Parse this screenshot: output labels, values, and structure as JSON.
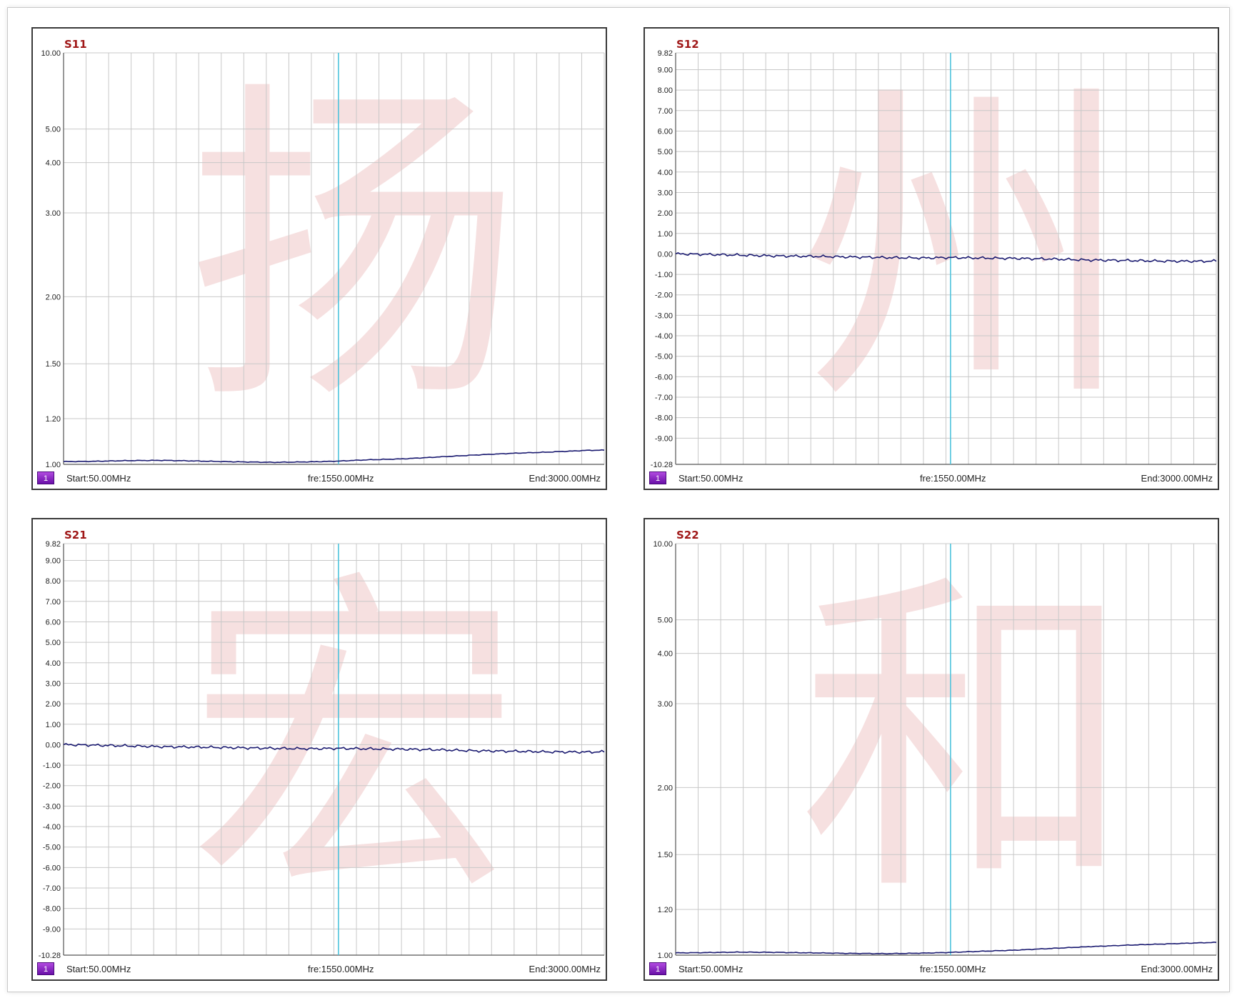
{
  "colors": {
    "grid": "#c8c8c8",
    "trace": "#1a1a70",
    "marker_line": "#4ec3dc",
    "title": "#a01818",
    "marker_badge": "#8a2bd0",
    "watermark": "#e9b4b4"
  },
  "panels": [
    {
      "title": "S11",
      "watermark": "扬",
      "marker_badge": "1",
      "start_label": "Start:50.00MHz",
      "fre_label": "fre:1550.00MHz",
      "end_label": "End:3000.00MHz"
    },
    {
      "title": "S12",
      "watermark": "州",
      "marker_badge": "1",
      "start_label": "Start:50.00MHz",
      "fre_label": "fre:1550.00MHz",
      "end_label": "End:3000.00MHz"
    },
    {
      "title": "S21",
      "watermark": "宏",
      "marker_badge": "1",
      "start_label": "Start:50.00MHz",
      "fre_label": "fre:1550.00MHz",
      "end_label": "End:3000.00MHz"
    },
    {
      "title": "S22",
      "watermark": "和",
      "marker_badge": "1",
      "start_label": "Start:50.00MHz",
      "fre_label": "fre:1550.00MHz",
      "end_label": "End:3000.00MHz"
    }
  ],
  "chart_data": [
    {
      "type": "line",
      "title": "S11",
      "scale": "vswr",
      "xlim": [
        50,
        3000
      ],
      "marker_x": 1550,
      "ylim": [
        1.0,
        10.0
      ],
      "yticks": [
        1.0,
        1.2,
        1.5,
        2.0,
        3.0,
        4.0,
        5.0,
        10.0
      ],
      "ytick_labels": [
        "1.00",
        "1.20",
        "1.50",
        "2.00",
        "3.00",
        "4.00",
        "5.00",
        "10.00"
      ],
      "grid": true,
      "series": [
        {
          "x": [
            50,
            200,
            400,
            600,
            800,
            1000,
            1200,
            1400,
            1550,
            1700,
            1900,
            2100,
            2300,
            2500,
            2700,
            2900,
            3000
          ],
          "values": [
            1.011,
            1.012,
            1.015,
            1.016,
            1.013,
            1.01,
            1.008,
            1.01,
            1.013,
            1.018,
            1.022,
            1.03,
            1.038,
            1.045,
            1.05,
            1.057,
            1.058
          ]
        }
      ]
    },
    {
      "type": "line",
      "title": "S12",
      "scale": "linear",
      "xlim": [
        50,
        3000
      ],
      "marker_x": 1550,
      "ylim": [
        -10.28,
        9.82
      ],
      "yticks": [
        -10.28,
        -9,
        -8,
        -7,
        -6,
        -5,
        -4,
        -3,
        -2,
        -1,
        0,
        1,
        2,
        3,
        4,
        5,
        6,
        7,
        8,
        9,
        9.82
      ],
      "ytick_labels": [
        "-10.28",
        "-9.00",
        "-8.00",
        "-7.00",
        "-6.00",
        "-5.00",
        "-4.00",
        "-3.00",
        "-2.00",
        "-1.00",
        "0.00",
        "1.00",
        "2.00",
        "3.00",
        "4.00",
        "5.00",
        "6.00",
        "7.00",
        "8.00",
        "9.00",
        "9.82"
      ],
      "grid": true,
      "series": [
        {
          "x": [
            50,
            200,
            400,
            600,
            800,
            1000,
            1200,
            1400,
            1550,
            1700,
            1900,
            2100,
            2300,
            2500,
            2700,
            2900,
            3000
          ],
          "values": [
            0.0,
            -0.02,
            -0.06,
            -0.1,
            -0.12,
            -0.15,
            -0.18,
            -0.2,
            -0.18,
            -0.2,
            -0.22,
            -0.25,
            -0.3,
            -0.32,
            -0.35,
            -0.36,
            -0.35
          ]
        }
      ]
    },
    {
      "type": "line",
      "title": "S21",
      "scale": "linear",
      "xlim": [
        50,
        3000
      ],
      "marker_x": 1550,
      "ylim": [
        -10.28,
        9.82
      ],
      "yticks": [
        -10.28,
        -9,
        -8,
        -7,
        -6,
        -5,
        -4,
        -3,
        -2,
        -1,
        0,
        1,
        2,
        3,
        4,
        5,
        6,
        7,
        8,
        9,
        9.82
      ],
      "ytick_labels": [
        "-10.28",
        "-9.00",
        "-8.00",
        "-7.00",
        "-6.00",
        "-5.00",
        "-4.00",
        "-3.00",
        "-2.00",
        "-1.00",
        "0.00",
        "1.00",
        "2.00",
        "3.00",
        "4.00",
        "5.00",
        "6.00",
        "7.00",
        "8.00",
        "9.00",
        "9.82"
      ],
      "grid": true,
      "series": [
        {
          "x": [
            50,
            200,
            400,
            600,
            800,
            1000,
            1200,
            1400,
            1550,
            1700,
            1900,
            2100,
            2300,
            2500,
            2700,
            2900,
            3000
          ],
          "values": [
            0.0,
            -0.02,
            -0.06,
            -0.1,
            -0.12,
            -0.15,
            -0.18,
            -0.2,
            -0.18,
            -0.2,
            -0.22,
            -0.25,
            -0.3,
            -0.32,
            -0.35,
            -0.36,
            -0.35
          ]
        }
      ]
    },
    {
      "type": "line",
      "title": "S22",
      "scale": "vswr",
      "xlim": [
        50,
        3000
      ],
      "marker_x": 1550,
      "ylim": [
        1.0,
        10.0
      ],
      "yticks": [
        1.0,
        1.2,
        1.5,
        2.0,
        3.0,
        4.0,
        5.0,
        10.0
      ],
      "ytick_labels": [
        "1.00",
        "1.20",
        "1.50",
        "2.00",
        "3.00",
        "4.00",
        "5.00",
        "10.00"
      ],
      "grid": true,
      "series": [
        {
          "x": [
            50,
            200,
            400,
            600,
            800,
            1000,
            1200,
            1400,
            1550,
            1700,
            1900,
            2100,
            2300,
            2500,
            2700,
            2900,
            3000
          ],
          "values": [
            1.009,
            1.01,
            1.012,
            1.011,
            1.009,
            1.007,
            1.006,
            1.008,
            1.011,
            1.015,
            1.02,
            1.027,
            1.034,
            1.04,
            1.045,
            1.05,
            1.052
          ]
        }
      ]
    }
  ]
}
